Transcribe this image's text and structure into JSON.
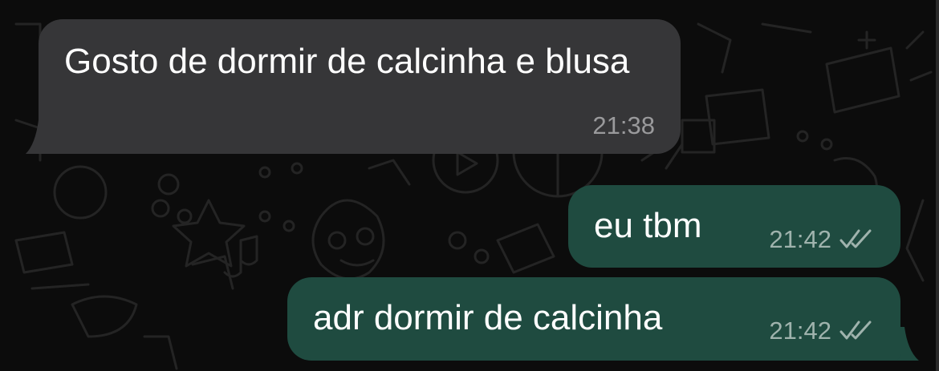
{
  "chat": {
    "messages": [
      {
        "direction": "incoming",
        "text": "Gosto de dormir de calcinha e blusa",
        "time": "21:38"
      },
      {
        "direction": "outgoing",
        "text": "eu tbm",
        "time": "21:42",
        "status_icon": "double-check-icon"
      },
      {
        "direction": "outgoing",
        "text": "adr dormir de calcinha",
        "time": "21:42",
        "status_icon": "double-check-icon"
      }
    ]
  },
  "colors": {
    "background": "#0c0c0c",
    "incoming_bubble": "#363638",
    "outgoing_bubble": "#1f4b40",
    "text": "#ffffff",
    "timestamp": "#9a9a9c"
  }
}
